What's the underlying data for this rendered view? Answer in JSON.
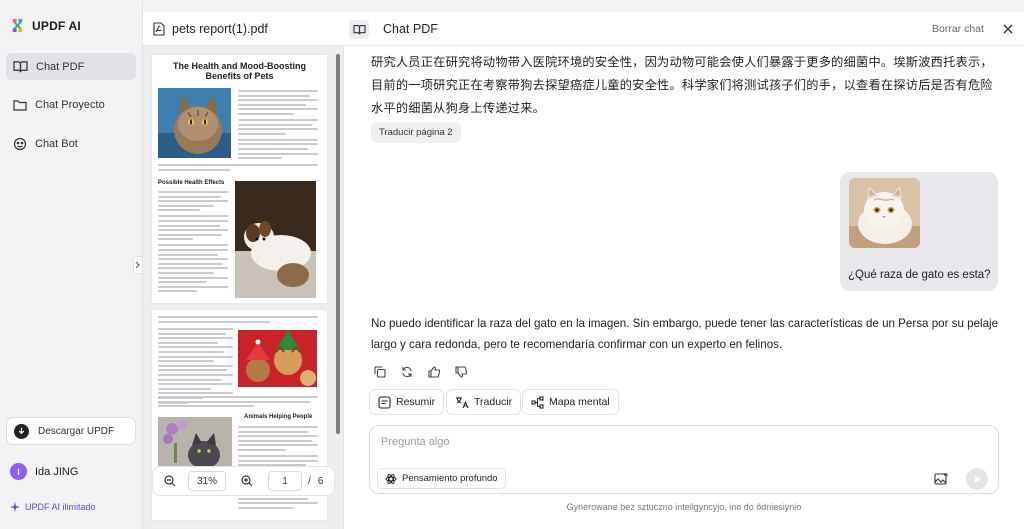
{
  "app": {
    "name": "UPDF AI"
  },
  "sidebar": {
    "items": [
      {
        "label": "Chat PDF",
        "icon": "book-icon",
        "active": true
      },
      {
        "label": "Chat Proyecto",
        "icon": "folder-icon",
        "active": false
      },
      {
        "label": "Chat Bot",
        "icon": "bot-icon",
        "active": false
      }
    ],
    "download_label": "Descargar UPDF",
    "user": {
      "initial": "I",
      "name": "Ida JING"
    },
    "plan_label": "UPDF AI ilimitado"
  },
  "pdf": {
    "file_name": "pets report(1).pdf",
    "doc_title": "The Health and Mood-Boosting Benefits of Pets",
    "section_1": "Possible Health Effects",
    "section_2": "Animals Helping People",
    "zoom": "31%",
    "current_page": "1",
    "page_separator": "/",
    "total_pages": "6"
  },
  "chat": {
    "title": "Chat PDF",
    "clear_label": "Borrar chat",
    "messages": {
      "ai_chinese": "研究人员正在研究将动物带入医院环境的安全性，因为动物可能会使人们暴露于更多的细菌中。埃斯波西托表示，目前的一项研究正在考察带狗去探望癌症儿童的安全性。科学家们将测试孩子们的手，以查看在探访后是否有危险水平的细菌从狗身上传递过来。",
      "translate_page_label": "Traducir página 2",
      "user_question": "¿Qué raza de gato es esta?",
      "ai_answer": "No puedo identificar la raza del gato en la imagen. Sin embargo, puede tener las características de un Persa por su pelaje largo y cara redonda, pero te recomendaría confirmar con un experto en felinos."
    },
    "actions": {
      "summary": "Resumir",
      "translate": "Traducir",
      "mindmap": "Mapa mental"
    },
    "input": {
      "placeholder": "Pregunta algo",
      "deep_think_label": "Pensamiento profundo"
    },
    "footer": "Gynerowane bez sztuczno inteligyncyjo, ino do ôdniesiynio"
  },
  "colors": {
    "accent": "#5b4ce0",
    "avatar": "#8b5cf6",
    "active_nav": "#e1e1e6"
  }
}
